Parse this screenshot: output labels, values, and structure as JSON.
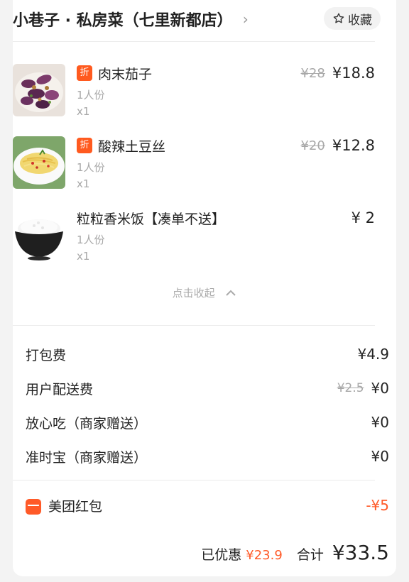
{
  "header": {
    "store_name": "小巷子 · 私房菜（七里新都店）",
    "chevron": "›",
    "favorite_label": "收藏",
    "favorite_icon": "star-outline-icon"
  },
  "items": [
    {
      "name": "肉末茄子",
      "discount_tag": "折",
      "portion": "1人份",
      "qty": "x1",
      "orig_price": "¥28",
      "price": "¥18.8",
      "image": "eggplant-dish"
    },
    {
      "name": "酸辣土豆丝",
      "discount_tag": "折",
      "portion": "1人份",
      "qty": "x1",
      "orig_price": "¥20",
      "price": "¥12.8",
      "image": "potato-strips-dish"
    },
    {
      "name": "粒粒香米饭【凑单不送】",
      "portion": "1人份",
      "qty": "x1",
      "price": "¥ 2",
      "image": "rice-bowl"
    }
  ],
  "collapse_label": "点击收起",
  "fees": [
    {
      "label": "打包费",
      "value": "¥4.9"
    },
    {
      "label": "用户配送费",
      "orig": "¥2.5",
      "value": "¥0"
    },
    {
      "label": "放心吃（商家赠送）",
      "value": "¥0"
    },
    {
      "label": "准时宝（商家赠送）",
      "value": "¥0"
    }
  ],
  "hongbao": {
    "label": "美团红包",
    "value": "-¥5"
  },
  "summary": {
    "saved_label": "已优惠",
    "saved_value": "¥23.9",
    "total_label": "合计",
    "total_value": "¥33.5"
  },
  "colors": {
    "accent": "#ff5a28",
    "muted": "#a8a8a8"
  }
}
